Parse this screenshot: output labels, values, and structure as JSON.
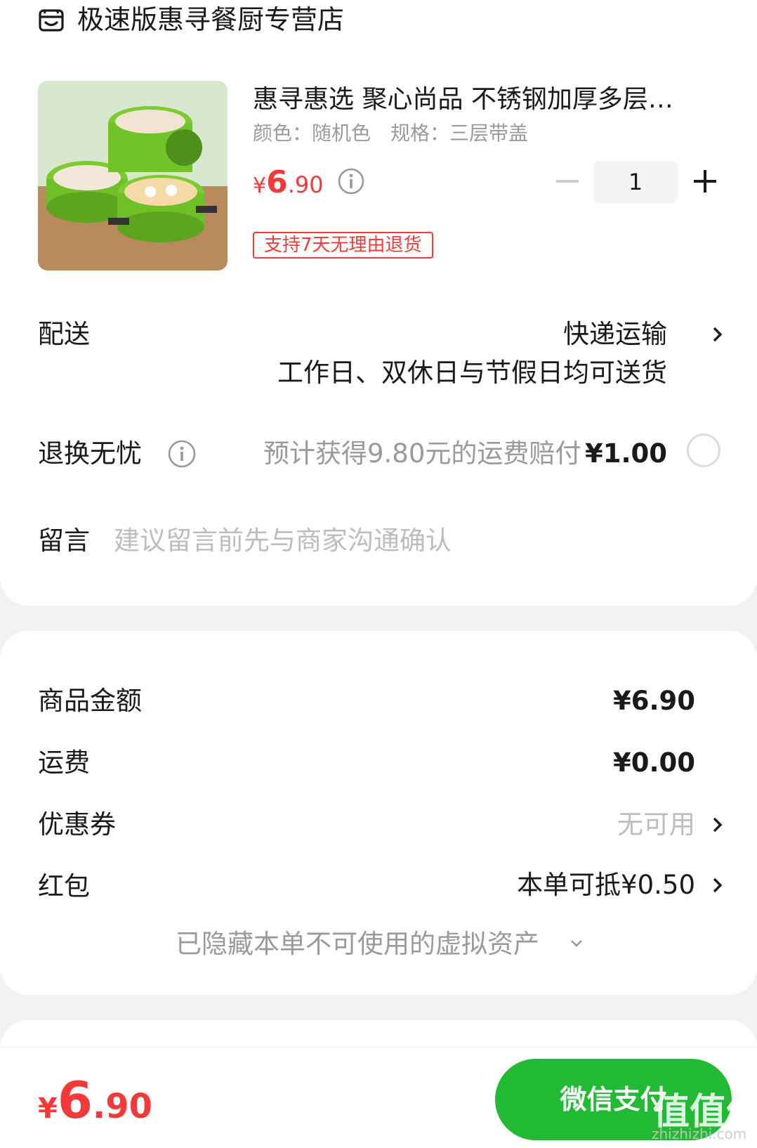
{
  "store": {
    "name": "极速版惠寻餐厨专营店",
    "icon": "store-icon"
  },
  "product": {
    "title": "惠寻惠选 聚心尚品 不锈钢加厚多层…",
    "spec": "颜色：随机色　规格：三层带盖",
    "price_currency": "¥",
    "price_int": "6",
    "price_dec": ".90",
    "quantity": "1",
    "return_badge": "支持7天无理由退货",
    "image": "green-lunchbox-photo"
  },
  "delivery": {
    "label": "配送",
    "value": "快递运输",
    "note": "工作日、双休日与节假日均可送货"
  },
  "worry_free": {
    "label": "退换无忧",
    "note": "预计获得9.80元的运费赔付",
    "price": "¥1.00",
    "selected": false
  },
  "message": {
    "label": "留言",
    "placeholder": "建议留言前先与商家沟通确认"
  },
  "summary": {
    "goods_label": "商品金额",
    "goods_value": "¥6.90",
    "shipping_label": "运费",
    "shipping_value": "¥0.00",
    "coupon_label": "优惠券",
    "coupon_value": "无可用",
    "redpacket_label": "红包",
    "redpacket_value": "本单可抵¥0.50",
    "hidden_assets": "已隐藏本单不可使用的虚拟资产"
  },
  "footer": {
    "total_currency": "¥",
    "total_int": "6",
    "total_dec": ".90",
    "pay_label": "微信支付"
  },
  "watermark": {
    "text": "值值值",
    "sub": "zhizhizhi.com"
  },
  "colors": {
    "accent_red": "#f23a3a",
    "pay_green": "#22b935"
  }
}
